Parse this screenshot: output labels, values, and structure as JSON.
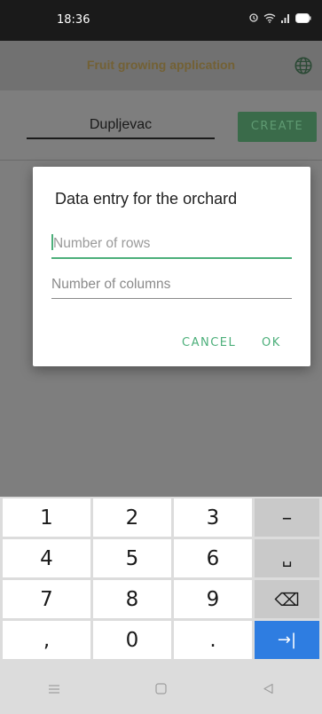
{
  "status_bar": {
    "time": "18:36"
  },
  "app_bar": {
    "title": "Fruit growing application"
  },
  "toolbar": {
    "name_value": "Dupljevac",
    "create_label": "CREATE"
  },
  "dialog": {
    "title": "Data entry for the orchard",
    "rows_placeholder": "Number of rows",
    "columns_placeholder": "Number of columns",
    "cancel_label": "CANCEL",
    "ok_label": "OK"
  },
  "keyboard": {
    "rows": [
      [
        "1",
        "2",
        "3",
        "–"
      ],
      [
        "4",
        "5",
        "6",
        "␣"
      ],
      [
        "7",
        "8",
        "9",
        "⌫"
      ],
      [
        ",",
        "0",
        ".",
        "→|"
      ]
    ]
  },
  "colors": {
    "accent": "#4caf7a",
    "enter": "#2e7de1",
    "title_text": "#736135"
  }
}
